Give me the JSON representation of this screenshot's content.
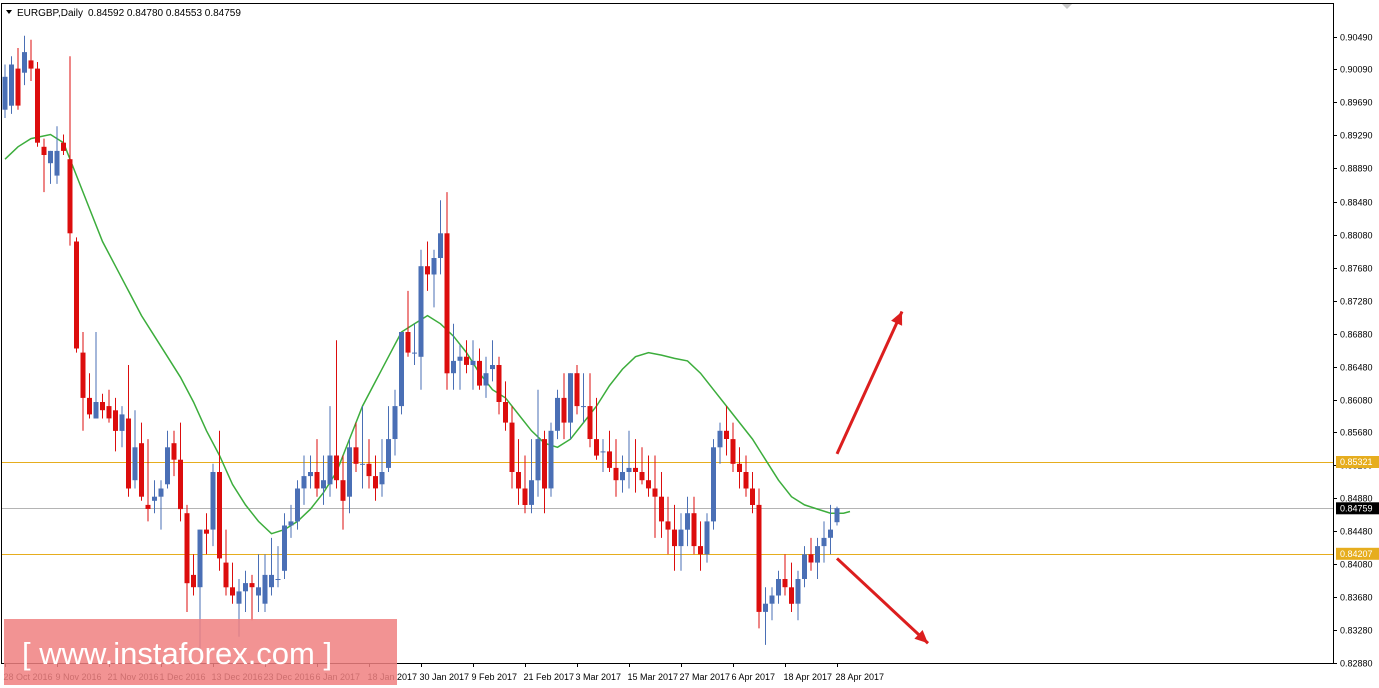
{
  "header": {
    "symbol": "EURGBP,Daily",
    "ohlc": "0.84592 0.84780 0.84553 0.84759"
  },
  "watermark": {
    "text": "[ www.instaforex.com ]",
    "color": "#f08080"
  },
  "colors": {
    "bull": "#4a6fb5",
    "bear": "#dc0d0d",
    "ma": "#3cad3c",
    "level": "#e6ad1e",
    "price_line": "#b4b4b4",
    "arrow": "#dc1e1e",
    "level_tag_text": "#ffffff",
    "last_tag_bg": "#000000"
  },
  "chart_data": {
    "type": "candlestick",
    "symbol": "EURGBP",
    "timeframe": "Daily",
    "ylim": [
      0.8264,
      0.9089
    ],
    "y_ticks": [
      "0.90490",
      "0.90090",
      "0.89690",
      "0.89290",
      "0.88890",
      "0.88480",
      "0.88080",
      "0.87680",
      "0.87280",
      "0.86880",
      "0.86480",
      "0.86080",
      "0.85680",
      "0.85280",
      "0.84880",
      "0.84480",
      "0.84080",
      "0.83680",
      "0.83280",
      "0.82880"
    ],
    "x_ticks": [
      {
        "label": "28 Oct 2016",
        "index": 0
      },
      {
        "label": "9 Nov 2016",
        "index": 8
      },
      {
        "label": "21 Nov 2016",
        "index": 16
      },
      {
        "label": "1 Dec 2016",
        "index": 24
      },
      {
        "label": "13 Dec 2016",
        "index": 32
      },
      {
        "label": "23 Dec 2016",
        "index": 40
      },
      {
        "label": "6 Jan 2017",
        "index": 48
      },
      {
        "label": "18 Jan 2017",
        "index": 56
      },
      {
        "label": "30 Jan 2017",
        "index": 64
      },
      {
        "label": "9 Feb 2017",
        "index": 72
      },
      {
        "label": "21 Feb 2017",
        "index": 80
      },
      {
        "label": "3 Mar 2017",
        "index": 88
      },
      {
        "label": "15 Mar 2017",
        "index": 96
      },
      {
        "label": "27 Mar 2017",
        "index": 104
      },
      {
        "label": "6 Apr 2017",
        "index": 112
      },
      {
        "label": "18 Apr 2017",
        "index": 120
      },
      {
        "label": "28 Apr 2017",
        "index": 128
      }
    ],
    "levels": [
      {
        "value": 0.85321,
        "label": "0.85321"
      },
      {
        "value": 0.84207,
        "label": "0.84207"
      }
    ],
    "last_price": {
      "value": 0.84759,
      "label": "0.84759"
    },
    "ohlc": [
      [
        0.896,
        0.9015,
        0.895,
        0.9
      ],
      [
        0.8965,
        0.9025,
        0.8955,
        0.9015
      ],
      [
        0.901,
        0.9035,
        0.896,
        0.8965
      ],
      [
        0.9005,
        0.905,
        0.899,
        0.903
      ],
      [
        0.902,
        0.9045,
        0.8995,
        0.901
      ],
      [
        0.901,
        0.9018,
        0.8915,
        0.892
      ],
      [
        0.8915,
        0.8925,
        0.886,
        0.8905
      ],
      [
        0.8895,
        0.891,
        0.887,
        0.891
      ],
      [
        0.888,
        0.894,
        0.887,
        0.891
      ],
      [
        0.892,
        0.893,
        0.8905,
        0.891
      ],
      [
        0.89,
        0.9025,
        0.8795,
        0.881
      ],
      [
        0.88,
        0.8805,
        0.8665,
        0.867
      ],
      [
        0.8665,
        0.869,
        0.857,
        0.861
      ],
      [
        0.861,
        0.864,
        0.8585,
        0.859
      ],
      [
        0.8585,
        0.869,
        0.8585,
        0.8605
      ],
      [
        0.8605,
        0.8615,
        0.8585,
        0.8595
      ],
      [
        0.86,
        0.862,
        0.858,
        0.8585
      ],
      [
        0.8595,
        0.861,
        0.8545,
        0.857
      ],
      [
        0.857,
        0.86,
        0.855,
        0.859
      ],
      [
        0.8585,
        0.865,
        0.849,
        0.85
      ],
      [
        0.851,
        0.8595,
        0.85,
        0.855
      ],
      [
        0.8555,
        0.858,
        0.8485,
        0.849
      ],
      [
        0.848,
        0.856,
        0.846,
        0.8475
      ],
      [
        0.8485,
        0.851,
        0.847,
        0.849
      ],
      [
        0.849,
        0.851,
        0.845,
        0.85
      ],
      [
        0.8505,
        0.857,
        0.85,
        0.855
      ],
      [
        0.8555,
        0.857,
        0.8515,
        0.8535
      ],
      [
        0.8535,
        0.858,
        0.846,
        0.8475
      ],
      [
        0.847,
        0.848,
        0.835,
        0.8385
      ],
      [
        0.8395,
        0.842,
        0.837,
        0.838
      ],
      [
        0.838,
        0.845,
        0.83,
        0.845
      ],
      [
        0.845,
        0.847,
        0.842,
        0.8445
      ],
      [
        0.845,
        0.853,
        0.843,
        0.852
      ],
      [
        0.852,
        0.857,
        0.84,
        0.8415
      ],
      [
        0.841,
        0.845,
        0.837,
        0.838
      ],
      [
        0.838,
        0.841,
        0.836,
        0.837
      ],
      [
        0.836,
        0.839,
        0.832,
        0.8375
      ],
      [
        0.8375,
        0.84,
        0.835,
        0.8385
      ],
      [
        0.8385,
        0.8395,
        0.834,
        0.838
      ],
      [
        0.837,
        0.842,
        0.835,
        0.838
      ],
      [
        0.836,
        0.842,
        0.835,
        0.8395
      ],
      [
        0.838,
        0.844,
        0.837,
        0.8395
      ],
      [
        0.839,
        0.843,
        0.838,
        0.839
      ],
      [
        0.84,
        0.847,
        0.839,
        0.8455
      ],
      [
        0.8455,
        0.848,
        0.844,
        0.846
      ],
      [
        0.846,
        0.851,
        0.845,
        0.85
      ],
      [
        0.85,
        0.854,
        0.848,
        0.8515
      ],
      [
        0.8515,
        0.854,
        0.85,
        0.852
      ],
      [
        0.852,
        0.856,
        0.849,
        0.85
      ],
      [
        0.85,
        0.854,
        0.848,
        0.851
      ],
      [
        0.8505,
        0.86,
        0.849,
        0.854
      ],
      [
        0.854,
        0.868,
        0.85,
        0.851
      ],
      [
        0.851,
        0.854,
        0.845,
        0.8485
      ],
      [
        0.849,
        0.856,
        0.847,
        0.855
      ],
      [
        0.855,
        0.858,
        0.852,
        0.853
      ],
      [
        0.853,
        0.86,
        0.85,
        0.853
      ],
      [
        0.853,
        0.856,
        0.85,
        0.8515
      ],
      [
        0.8515,
        0.854,
        0.8485,
        0.85
      ],
      [
        0.8505,
        0.856,
        0.849,
        0.852
      ],
      [
        0.8525,
        0.86,
        0.852,
        0.856
      ],
      [
        0.856,
        0.862,
        0.854,
        0.86
      ],
      [
        0.86,
        0.869,
        0.859,
        0.869
      ],
      [
        0.869,
        0.874,
        0.866,
        0.8665
      ],
      [
        0.8665,
        0.87,
        0.865,
        0.8665
      ],
      [
        0.866,
        0.879,
        0.862,
        0.877
      ],
      [
        0.877,
        0.88,
        0.874,
        0.876
      ],
      [
        0.876,
        0.879,
        0.872,
        0.878
      ],
      [
        0.878,
        0.885,
        0.876,
        0.881
      ],
      [
        0.881,
        0.886,
        0.862,
        0.864
      ],
      [
        0.864,
        0.87,
        0.862,
        0.8655
      ],
      [
        0.8655,
        0.8675,
        0.862,
        0.866
      ],
      [
        0.866,
        0.868,
        0.864,
        0.865
      ],
      [
        0.865,
        0.868,
        0.862,
        0.8655
      ],
      [
        0.8655,
        0.867,
        0.862,
        0.8625
      ],
      [
        0.8625,
        0.866,
        0.861,
        0.864
      ],
      [
        0.8645,
        0.868,
        0.863,
        0.865
      ],
      [
        0.865,
        0.866,
        0.859,
        0.8605
      ],
      [
        0.8605,
        0.863,
        0.857,
        0.858
      ],
      [
        0.858,
        0.86,
        0.85,
        0.852
      ],
      [
        0.852,
        0.856,
        0.848,
        0.85
      ],
      [
        0.85,
        0.854,
        0.847,
        0.848
      ],
      [
        0.848,
        0.856,
        0.847,
        0.851
      ],
      [
        0.851,
        0.862,
        0.849,
        0.856
      ],
      [
        0.856,
        0.857,
        0.847,
        0.85
      ],
      [
        0.85,
        0.858,
        0.849,
        0.857
      ],
      [
        0.857,
        0.862,
        0.856,
        0.861
      ],
      [
        0.861,
        0.864,
        0.856,
        0.858
      ],
      [
        0.858,
        0.864,
        0.856,
        0.864
      ],
      [
        0.864,
        0.865,
        0.859,
        0.86
      ],
      [
        0.86,
        0.864,
        0.858,
        0.86
      ],
      [
        0.86,
        0.864,
        0.855,
        0.856
      ],
      [
        0.856,
        0.861,
        0.8535,
        0.854
      ],
      [
        0.8545,
        0.856,
        0.852,
        0.8545
      ],
      [
        0.8545,
        0.857,
        0.852,
        0.8525
      ],
      [
        0.8525,
        0.856,
        0.849,
        0.851
      ],
      [
        0.851,
        0.854,
        0.8495,
        0.852
      ],
      [
        0.852,
        0.857,
        0.85,
        0.8525
      ],
      [
        0.8525,
        0.856,
        0.8495,
        0.852
      ],
      [
        0.852,
        0.855,
        0.8505,
        0.851
      ],
      [
        0.851,
        0.854,
        0.849,
        0.85
      ],
      [
        0.85,
        0.854,
        0.844,
        0.849
      ],
      [
        0.849,
        0.852,
        0.844,
        0.846
      ],
      [
        0.846,
        0.849,
        0.842,
        0.845
      ],
      [
        0.845,
        0.848,
        0.84,
        0.843
      ],
      [
        0.843,
        0.847,
        0.84,
        0.845
      ],
      [
        0.845,
        0.849,
        0.843,
        0.847
      ],
      [
        0.847,
        0.849,
        0.842,
        0.843
      ],
      [
        0.843,
        0.846,
        0.84,
        0.842
      ],
      [
        0.842,
        0.847,
        0.841,
        0.846
      ],
      [
        0.846,
        0.856,
        0.845,
        0.855
      ],
      [
        0.855,
        0.858,
        0.853,
        0.857
      ],
      [
        0.857,
        0.86,
        0.854,
        0.856
      ],
      [
        0.856,
        0.858,
        0.852,
        0.853
      ],
      [
        0.853,
        0.855,
        0.85,
        0.852
      ],
      [
        0.852,
        0.854,
        0.849,
        0.85
      ],
      [
        0.85,
        0.852,
        0.847,
        0.848
      ],
      [
        0.848,
        0.85,
        0.833,
        0.835
      ],
      [
        0.835,
        0.838,
        0.831,
        0.836
      ],
      [
        0.836,
        0.838,
        0.834,
        0.837
      ],
      [
        0.837,
        0.84,
        0.836,
        0.839
      ],
      [
        0.839,
        0.842,
        0.837,
        0.838
      ],
      [
        0.838,
        0.841,
        0.835,
        0.836
      ],
      [
        0.836,
        0.84,
        0.834,
        0.839
      ],
      [
        0.839,
        0.843,
        0.838,
        0.842
      ],
      [
        0.842,
        0.844,
        0.84,
        0.841
      ],
      [
        0.841,
        0.844,
        0.839,
        0.843
      ],
      [
        0.843,
        0.846,
        0.841,
        0.844
      ],
      [
        0.844,
        0.848,
        0.842,
        0.845
      ],
      [
        0.8459,
        0.8478,
        0.8455,
        0.8476
      ]
    ],
    "ma": [
      [
        0,
        0.89
      ],
      [
        2,
        0.8915
      ],
      [
        4,
        0.8925
      ],
      [
        7,
        0.893
      ],
      [
        9,
        0.892
      ],
      [
        11,
        0.888
      ],
      [
        13,
        0.884
      ],
      [
        15,
        0.88
      ],
      [
        17,
        0.877
      ],
      [
        19,
        0.874
      ],
      [
        21,
        0.871
      ],
      [
        23,
        0.8685
      ],
      [
        25,
        0.866
      ],
      [
        27,
        0.8635
      ],
      [
        29,
        0.8605
      ],
      [
        31,
        0.857
      ],
      [
        33,
        0.854
      ],
      [
        35,
        0.8505
      ],
      [
        37,
        0.848
      ],
      [
        39,
        0.846
      ],
      [
        41,
        0.8445
      ],
      [
        43,
        0.845
      ],
      [
        45,
        0.846
      ],
      [
        47,
        0.8475
      ],
      [
        49,
        0.8495
      ],
      [
        51,
        0.852
      ],
      [
        53,
        0.856
      ],
      [
        55,
        0.86
      ],
      [
        57,
        0.863
      ],
      [
        59,
        0.866
      ],
      [
        61,
        0.869
      ],
      [
        63,
        0.87
      ],
      [
        65,
        0.871
      ],
      [
        67,
        0.87
      ],
      [
        69,
        0.8685
      ],
      [
        71,
        0.8665
      ],
      [
        73,
        0.864
      ],
      [
        75,
        0.862
      ],
      [
        77,
        0.861
      ],
      [
        79,
        0.859
      ],
      [
        81,
        0.857
      ],
      [
        83,
        0.8555
      ],
      [
        85,
        0.855
      ],
      [
        87,
        0.856
      ],
      [
        89,
        0.858
      ],
      [
        91,
        0.86
      ],
      [
        93,
        0.8625
      ],
      [
        95,
        0.8645
      ],
      [
        97,
        0.866
      ],
      [
        99,
        0.8665
      ],
      [
        101,
        0.8662
      ],
      [
        103,
        0.8658
      ],
      [
        105,
        0.8655
      ],
      [
        107,
        0.864
      ],
      [
        109,
        0.862
      ],
      [
        111,
        0.86
      ],
      [
        113,
        0.858
      ],
      [
        115,
        0.856
      ],
      [
        117,
        0.8535
      ],
      [
        119,
        0.851
      ],
      [
        121,
        0.849
      ],
      [
        123,
        0.848
      ],
      [
        125,
        0.8475
      ],
      [
        127,
        0.847
      ],
      [
        129,
        0.847
      ],
      [
        130,
        0.8472
      ]
    ],
    "arrows": [
      {
        "from": [
          0.8542,
          128
        ],
        "to": [
          0.8715,
          138
        ]
      },
      {
        "from": [
          0.8415,
          128
        ],
        "to": [
          0.8312,
          142
        ]
      }
    ]
  }
}
